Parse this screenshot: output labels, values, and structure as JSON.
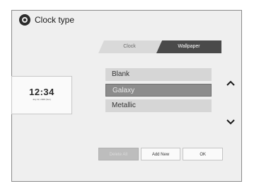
{
  "window": {
    "title": "Clock type"
  },
  "tabs": [
    {
      "label": "Clock",
      "active": false
    },
    {
      "label": "Wallpaper",
      "active": true
    }
  ],
  "preview": {
    "time": "12:34",
    "date": "July 22, 2008 (Sun)"
  },
  "list": {
    "items": [
      {
        "label": "Blank"
      },
      {
        "label": "Galaxy",
        "selected": true
      },
      {
        "label": "Metallic"
      }
    ]
  },
  "buttons": {
    "delete_all": "Delete All",
    "add_new": "Add New",
    "ok": "OK"
  },
  "icons": {
    "settings": "gear-icon",
    "up": "chevron-up-icon",
    "down": "chevron-down-icon"
  },
  "colors": {
    "active_tab": "#4a4a4a",
    "selected_item": "#8c8c8c",
    "frame_border": "#8a8a8a"
  }
}
